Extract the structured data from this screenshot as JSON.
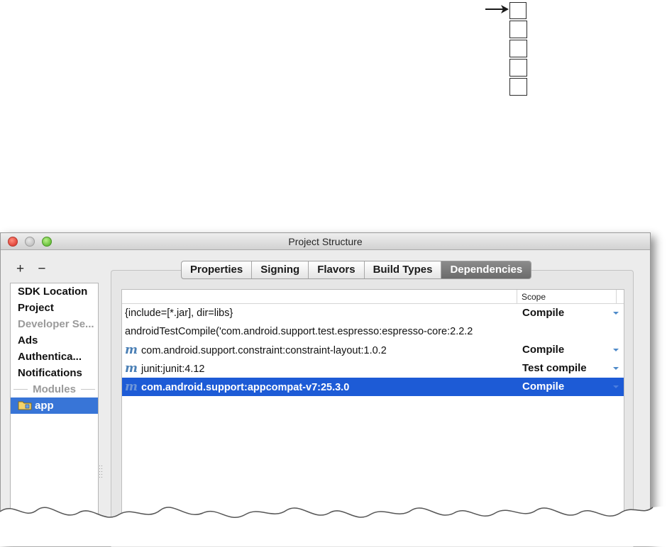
{
  "window": {
    "title": "Project Structure"
  },
  "sidebar": {
    "add_label": "+",
    "remove_label": "−",
    "items": [
      {
        "label": "SDK Location"
      },
      {
        "label": "Project"
      },
      {
        "label": "Developer Se..."
      },
      {
        "label": "Ads"
      },
      {
        "label": "Authentica..."
      },
      {
        "label": "Notifications"
      }
    ],
    "section_label": "Modules",
    "module_item": "app"
  },
  "tabs": [
    {
      "label": "Properties"
    },
    {
      "label": "Signing"
    },
    {
      "label": "Flavors"
    },
    {
      "label": "Build Types"
    },
    {
      "label": "Dependencies"
    }
  ],
  "dependencies": {
    "scope_header": "Scope",
    "module_icon": "m",
    "rows": [
      {
        "name": "{include=[*.jar], dir=libs}",
        "scope": "Compile"
      },
      {
        "name": "androidTestCompile('com.android.support.test.espresso:espresso-core:2.2.2",
        "scope": ""
      },
      {
        "name": "com.android.support.constraint:constraint-layout:1.0.2",
        "scope": "Compile"
      },
      {
        "name": "junit:junit:4.12",
        "scope": "Test compile"
      },
      {
        "name": "com.android.support:appcompat-v7:25.3.0",
        "scope": "Compile"
      }
    ]
  },
  "colors": {
    "selection": "#1d5bd6",
    "sidebar_selection": "#3875d7",
    "module_icon": "#4a7fb5",
    "dropdown_caret": "#4e8ac9"
  }
}
